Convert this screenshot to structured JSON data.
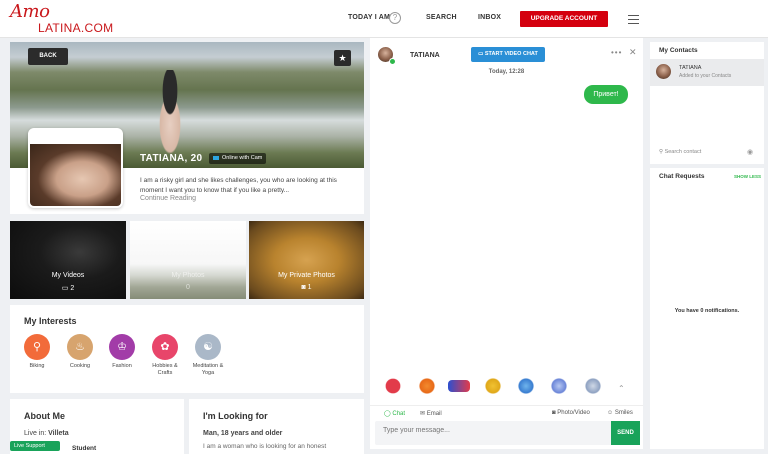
{
  "header": {
    "logo_script": "Amo",
    "logo_sub": "LATINA.COM",
    "nav": [
      "TODAY I AM",
      "SEARCH",
      "INBOX"
    ],
    "help_glyph": "?",
    "upgrade_label": "UPGRADE ACCOUNT",
    "accent_color": "#d4000e"
  },
  "profile": {
    "back_label": "BACK",
    "star_glyph": "★",
    "name": "TATIANA, 20",
    "online_label": "Online with Cam",
    "bio": "I am a risky girl and she likes challenges, you who are looking at this moment I want you to know that if you like a pretty...",
    "continue_label": "Continue Reading"
  },
  "media": [
    {
      "label": "My Videos",
      "count": "2",
      "icon": "video-icon"
    },
    {
      "label": "My Photos",
      "count": "0",
      "icon": "camera-icon"
    },
    {
      "label": "My Private Photos",
      "count": "1",
      "icon": "camera-icon"
    }
  ],
  "interests": {
    "title": "My Interests",
    "items": [
      {
        "label": "Biking",
        "color": "#f26b3a",
        "icon": "bike-icon",
        "glyph": "⚲"
      },
      {
        "label": "Cooking",
        "color": "#d7a46e",
        "icon": "cooking-pot-icon",
        "glyph": "♨"
      },
      {
        "label": "Fashion",
        "color": "#a23ca8",
        "icon": "hat-icon",
        "glyph": "♔"
      },
      {
        "label": "Hobbies & Crafts",
        "color": "#e8456a",
        "icon": "yarn-icon",
        "glyph": "✿"
      },
      {
        "label": "Meditation & Yoga",
        "color": "#aab8c8",
        "icon": "meditation-icon",
        "glyph": "☯"
      }
    ]
  },
  "about": {
    "title": "About Me",
    "live_in_label": "Live in:",
    "live_in_value": "Villeta",
    "extra": "Student"
  },
  "looking": {
    "title": "I'm Looking for",
    "summary": "Man, 18 years and older",
    "text": "I am a woman who is looking for an honest"
  },
  "live_support_label": "Live Support",
  "chat": {
    "name": "TATIANA",
    "video_label": "START VIDEO CHAT",
    "more_glyph": "•••",
    "close_glyph": "✕",
    "date": "Today, 12:28",
    "message": "Привет!",
    "tabs": [
      "Chat",
      "Email",
      "Photo/Video",
      "Smiles"
    ],
    "input_placeholder": "Type your message...",
    "send_label": "SEND",
    "chevron_glyph": "⌃",
    "stickers": [
      "heart-arrow-sticker",
      "fox-sticker",
      "car-sticker",
      "crown-sticker",
      "bird-sticker",
      "cake-sticker",
      "plane-sticker"
    ],
    "green": "#2eb84b"
  },
  "contacts": {
    "title": "My Contacts",
    "items": [
      {
        "name": "TATIANA",
        "status": "Added to your Contacts"
      }
    ],
    "search_placeholder": "Search contact"
  },
  "requests": {
    "title": "Chat Requests",
    "show_less": "SHOW LESS",
    "empty": "You have 0 notifications."
  }
}
